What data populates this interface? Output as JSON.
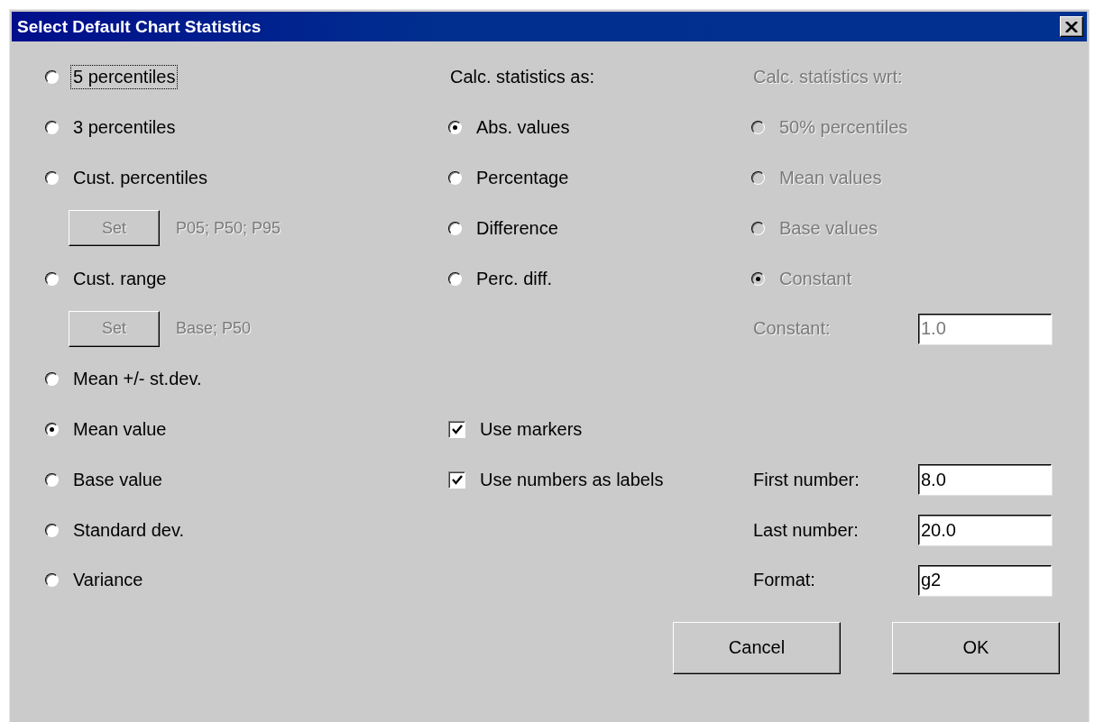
{
  "window": {
    "title": "Select Default Chart Statistics"
  },
  "statistics": [
    {
      "label": "5 percentiles",
      "selected": false,
      "focused": true
    },
    {
      "label": "3 percentiles",
      "selected": false,
      "focused": false
    },
    {
      "label": "Cust. percentiles",
      "selected": false,
      "focused": false,
      "set_button": {
        "label": "Set",
        "disabled": true
      },
      "summary": "P05; P50; P95"
    },
    {
      "label": "Cust. range",
      "selected": false,
      "focused": false,
      "set_button": {
        "label": "Set",
        "disabled": true
      },
      "summary": "Base; P50"
    },
    {
      "label": "Mean +/- st.dev.",
      "selected": false,
      "focused": false
    },
    {
      "label": "Mean value",
      "selected": true,
      "focused": false
    },
    {
      "label": "Base value",
      "selected": false,
      "focused": false
    },
    {
      "label": "Standard dev.",
      "selected": false,
      "focused": false
    },
    {
      "label": "Variance",
      "selected": false,
      "focused": false
    }
  ],
  "calc_as": {
    "heading": "Calc. statistics as:",
    "disabled": false,
    "options": [
      {
        "label": "Abs. values",
        "selected": true
      },
      {
        "label": "Percentage",
        "selected": false
      },
      {
        "label": "Difference",
        "selected": false
      },
      {
        "label": "Perc. diff.",
        "selected": false
      }
    ]
  },
  "calc_wrt": {
    "heading": "Calc. statistics wrt:",
    "disabled": true,
    "options": [
      {
        "label": "50% percentiles",
        "selected": false
      },
      {
        "label": "Mean values",
        "selected": false
      },
      {
        "label": "Base values",
        "selected": false
      },
      {
        "label": "Constant",
        "selected": true
      }
    ],
    "constant_field": {
      "label": "Constant:",
      "value": "1.0"
    }
  },
  "checkboxes": [
    {
      "label": "Use markers",
      "checked": true
    },
    {
      "label": "Use numbers as labels",
      "checked": true
    }
  ],
  "number_fields": [
    {
      "label": "First number:",
      "value": "8.0"
    },
    {
      "label": "Last number:",
      "value": "20.0"
    },
    {
      "label": "Format:",
      "value": "g2"
    }
  ],
  "buttons": [
    {
      "label": "Cancel"
    },
    {
      "label": "OK"
    }
  ]
}
